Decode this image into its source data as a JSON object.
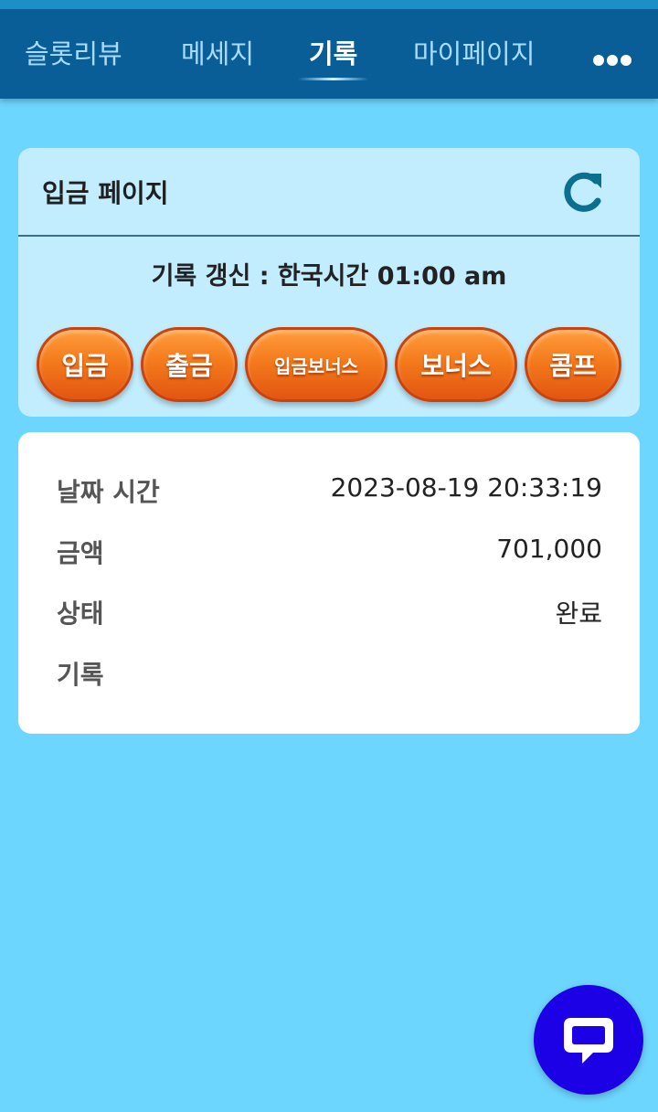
{
  "nav": {
    "tabs": [
      {
        "label": "슬롯리뷰"
      },
      {
        "label": "메세지"
      },
      {
        "label": "기록",
        "active": true
      },
      {
        "label": "마이페이지"
      }
    ],
    "more_icon": "more-dots-icon"
  },
  "panel": {
    "title": "입금 페이지",
    "refresh_icon": "refresh-icon",
    "update_text": "기록 갱신 : 한국시간 01:00 am",
    "buttons": [
      {
        "label": "입금"
      },
      {
        "label": "출금"
      },
      {
        "label": "입금보너스"
      },
      {
        "label": "보너스"
      },
      {
        "label": "콤프"
      }
    ]
  },
  "record": {
    "rows": [
      {
        "label": "날짜 시간",
        "value": "2023-08-19 20:33:19"
      },
      {
        "label": "금액",
        "value": "701,000"
      },
      {
        "label": "상태",
        "value": "완료"
      },
      {
        "label": "기록",
        "value": ""
      }
    ]
  },
  "chat": {
    "icon": "chat-bubble-icon"
  },
  "colors": {
    "background": "#6dd6ff",
    "topbar": "#0a5e98",
    "panel": "#c1edff",
    "button_orange": "#f47a1c",
    "chat_button": "#1c00e6"
  }
}
